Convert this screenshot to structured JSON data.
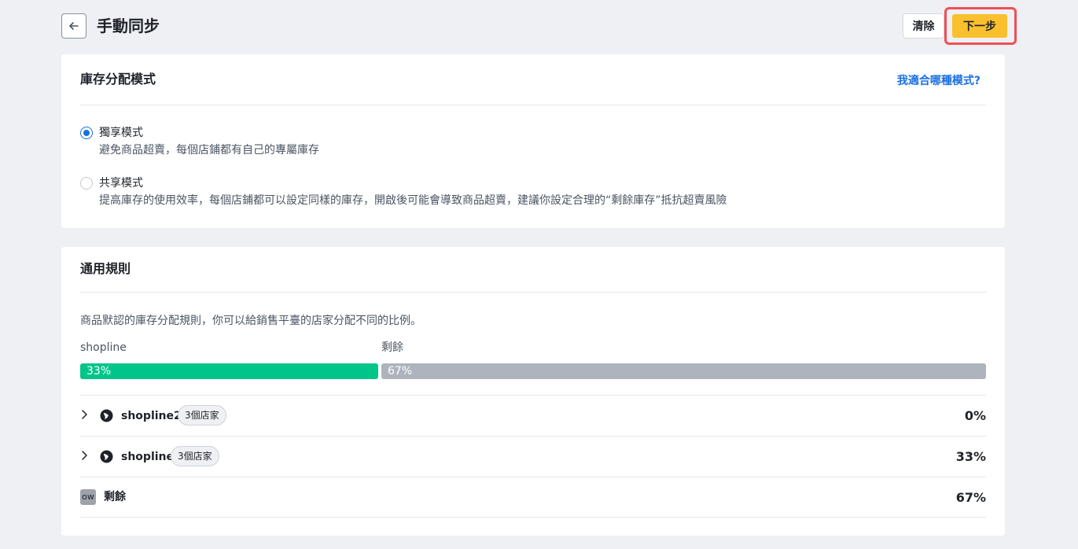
{
  "header": {
    "title": "手動同步",
    "clear_label": "清除",
    "next_label": "下一步"
  },
  "allocation_mode": {
    "title": "庫存分配模式",
    "help_link": "我適合哪種模式?",
    "options": [
      {
        "label": "獨享模式",
        "description": "避免商品超賣，每個店鋪都有自己的專屬庫存",
        "selected": true
      },
      {
        "label": "共享模式",
        "description": "提高庫存的使用效率，每個店鋪都可以設定同樣的庫存，開啟後可能會導致商品超賣，建議你設定合理的“剩餘庫存”抵抗超賣風險",
        "selected": false
      }
    ]
  },
  "general_rules": {
    "title": "通用規則",
    "description": "商品默認的庫存分配規則，你可以給銷售平臺的店家分配不同的比例。",
    "bar": [
      {
        "label": "shopline",
        "value_text": "33%",
        "fraction": 0.33,
        "color": "#00c58a"
      },
      {
        "label": "剩餘",
        "value_text": "67%",
        "fraction": 0.67,
        "color": "#aeb3bd"
      }
    ],
    "rows": [
      {
        "name": "shopline2",
        "badge": "3個店家",
        "value": "0%"
      },
      {
        "name": "shopline",
        "badge": "3個店家",
        "value": "33%"
      }
    ],
    "remaining": {
      "badge": "ow",
      "name": "剩餘",
      "value": "67%"
    }
  }
}
